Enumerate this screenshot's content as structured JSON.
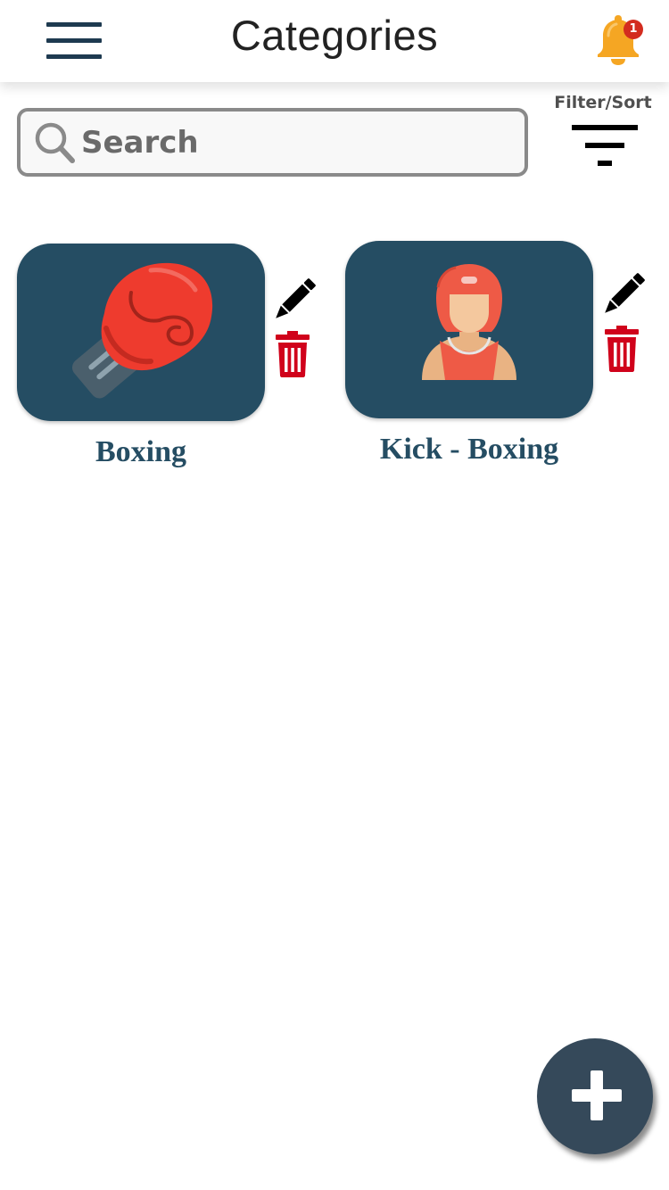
{
  "header": {
    "title": "Categories",
    "notification_count": "1"
  },
  "search": {
    "placeholder": "Search"
  },
  "filter": {
    "label": "Filter/Sort"
  },
  "categories": [
    {
      "name": "Boxing",
      "icon": "boxing-glove-icon"
    },
    {
      "name": "Kick - Boxing",
      "icon": "kickboxer-icon"
    }
  ],
  "colors": {
    "card_background": "#254d63",
    "card_title": "#254d63",
    "menu": "#1e3a50",
    "delete": "#d0021b",
    "fab": "#35495a",
    "bell": "#f5a623",
    "badge": "#d32c1f"
  }
}
